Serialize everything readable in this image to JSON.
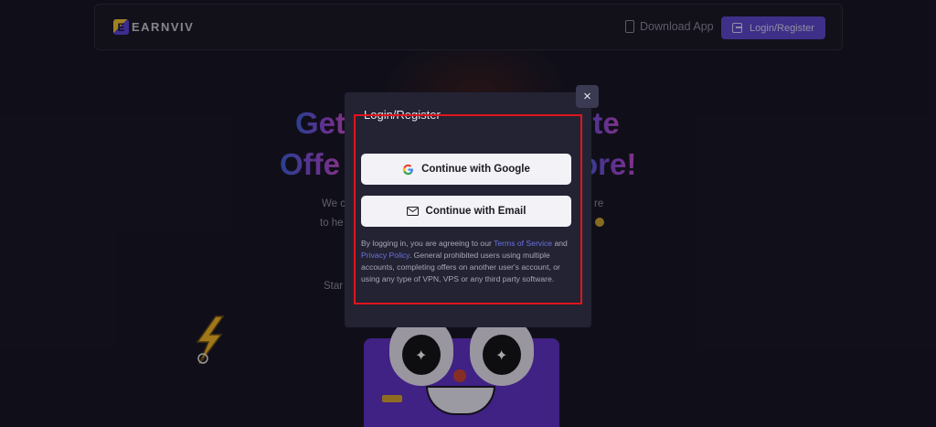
{
  "navbar": {
    "brand_logo_letter": "E",
    "brand_name": "EARNVIV",
    "download_label": "Download App",
    "login_label": "Login/Register"
  },
  "hero": {
    "line1_left": "Get",
    "line1_right": "ete",
    "line2_left": "Offe",
    "line2_right": "ore!",
    "sub_a": "We c",
    "sub_b": "re",
    "sub_c": "to he",
    "sub_d": "Star"
  },
  "modal": {
    "title": "Login/Register",
    "close_label": "×",
    "google_label": "Continue with Google",
    "email_label": "Continue with Email",
    "legal_prefix": "By logging in, you are agreeing to our ",
    "terms_link": "Terms of Service",
    "legal_and": " and ",
    "privacy_link": "Privacy Policy",
    "legal_suffix": ". General prohibited users using multiple accounts, completing offers on another user's account, or using any type of VPN, VPS or any third party software."
  },
  "colors": {
    "accent": "#5b46c9",
    "link": "#6b72e0",
    "highlight": "#e0141c"
  }
}
